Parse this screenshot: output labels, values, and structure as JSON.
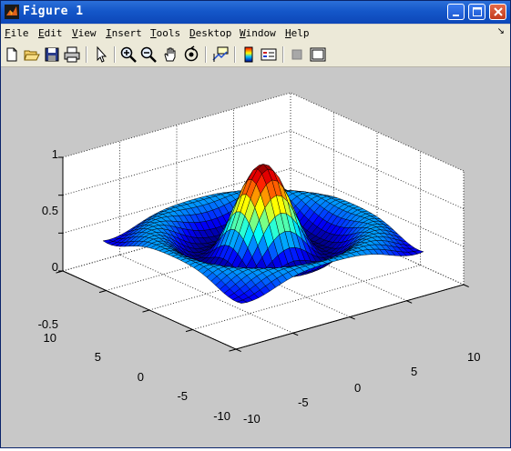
{
  "window": {
    "title": "Figure 1",
    "title_bg": "#1457c9"
  },
  "menubar": {
    "items": [
      {
        "label": "File",
        "key": "F"
      },
      {
        "label": "Edit",
        "key": "E"
      },
      {
        "label": "View",
        "key": "V"
      },
      {
        "label": "Insert",
        "key": "I"
      },
      {
        "label": "Tools",
        "key": "T"
      },
      {
        "label": "Desktop",
        "key": "D"
      },
      {
        "label": "Window",
        "key": "W"
      },
      {
        "label": "Help",
        "key": "H"
      }
    ]
  },
  "toolbar": {
    "icons": [
      "new-figure-icon",
      "open-file-icon",
      "save-icon",
      "print-icon",
      "edit-plot-arrow-icon",
      "zoom-in-icon",
      "zoom-out-icon",
      "pan-hand-icon",
      "rotate-3d-icon",
      "data-cursor-icon",
      "colorbar-icon",
      "legend-icon",
      "hide-plot-tools-icon",
      "show-plot-tools-icon"
    ]
  },
  "plot": {
    "background": "#c8c8c8",
    "axes_color": "#ffffff",
    "z_ticks": [
      "1",
      "0.5",
      "0",
      "-0.5"
    ],
    "y_ticks": [
      "10",
      "5",
      "0",
      "-5",
      "-10"
    ],
    "x_ticks": [
      "-10",
      "-5",
      "0",
      "5",
      "10"
    ]
  },
  "chart_data": {
    "type": "surface",
    "function": "z = sin(r)/r, r = sqrt(x^2 + y^2)",
    "x_range": [
      -8,
      8
    ],
    "y_range": [
      -8,
      8
    ],
    "xlim": [
      -10,
      10
    ],
    "ylim": [
      -10,
      10
    ],
    "zlim": [
      -0.5,
      1
    ],
    "grid": true,
    "colormap": "jet"
  }
}
